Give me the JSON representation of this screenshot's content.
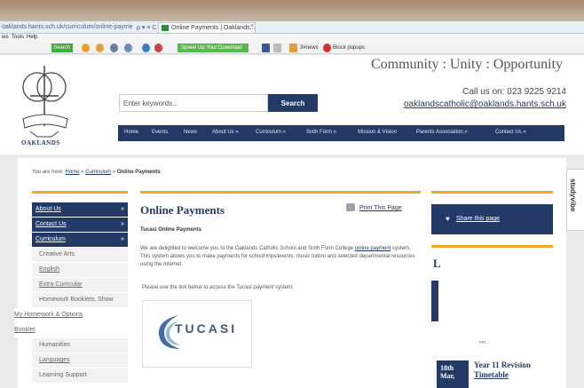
{
  "browser": {
    "url": "oaklands.hants.sch.uk/curriculum/online-payme",
    "controls": "ρ ▾ ≡ C ×",
    "tab_active": "Online Payments | Oaklands...",
    "tab_close": "×",
    "menu": [
      "ies",
      "Tools",
      "Help"
    ],
    "toolbar": {
      "search_label": "Search",
      "speed_label": "Speed Up Your Download",
      "news_label": "3#news",
      "block_label": "Block popups"
    }
  },
  "site": {
    "logo_text": "OAKLANDS",
    "motto": "Community : Unity : Opportunity",
    "phone": "Call us on: 023 9225 9214",
    "email": "oaklandscatholic@oaklands.hants.sch.uk",
    "search": {
      "placeholder": "Enter keywords...",
      "button": "Search"
    },
    "nav": [
      "Home",
      "Events",
      "News",
      "About Us »",
      "Curriculum »",
      "Sixth Form »",
      "Mission & Vision",
      "Parents Association »",
      "Contact Us »"
    ]
  },
  "breadcrumb": {
    "prefix": "You are here:",
    "home": "Home",
    "sep1": "»",
    "curriculum": "Curriculum",
    "sep2": "»",
    "current": "Online Payments"
  },
  "sidebar": {
    "items": [
      {
        "label": "About Us"
      },
      {
        "label": "Contact Us"
      },
      {
        "label": "Curriculum"
      },
      {
        "label": "Creative Arts"
      },
      {
        "label": "English"
      },
      {
        "label": "Extra Curricular"
      },
      {
        "label": "Homework Booklets, Show"
      },
      {
        "label": "My Homework & Options"
      },
      {
        "label": "Booklet"
      },
      {
        "label": "Humanities"
      },
      {
        "label": "Languages"
      },
      {
        "label": "Learning Support"
      }
    ]
  },
  "content": {
    "title": "Online Payments",
    "print_label": "Print This Page",
    "subheading": "Tucasi Online Payments",
    "para_a": "We are delighted to welcome you to the Oaklands Catholic School and Sixth Form College ",
    "para_link": "online payment",
    "para_b": " system. This system allows you to make payments for school trips/events, music tuition and selected departmental resources using the Internet.",
    "para2": "Please use the link below to access the Tucasi payment system:",
    "tucasi_logo_text": "TUCASI"
  },
  "right": {
    "share_label": "Share this page",
    "heading_letter": "L",
    "more_text": "ent...",
    "event": {
      "date_day": "18th",
      "date_month": "Mar,",
      "title_line1": "Year 11 Revision",
      "title_line2": "Timetable"
    }
  },
  "studyvibe": "studyvibe"
}
